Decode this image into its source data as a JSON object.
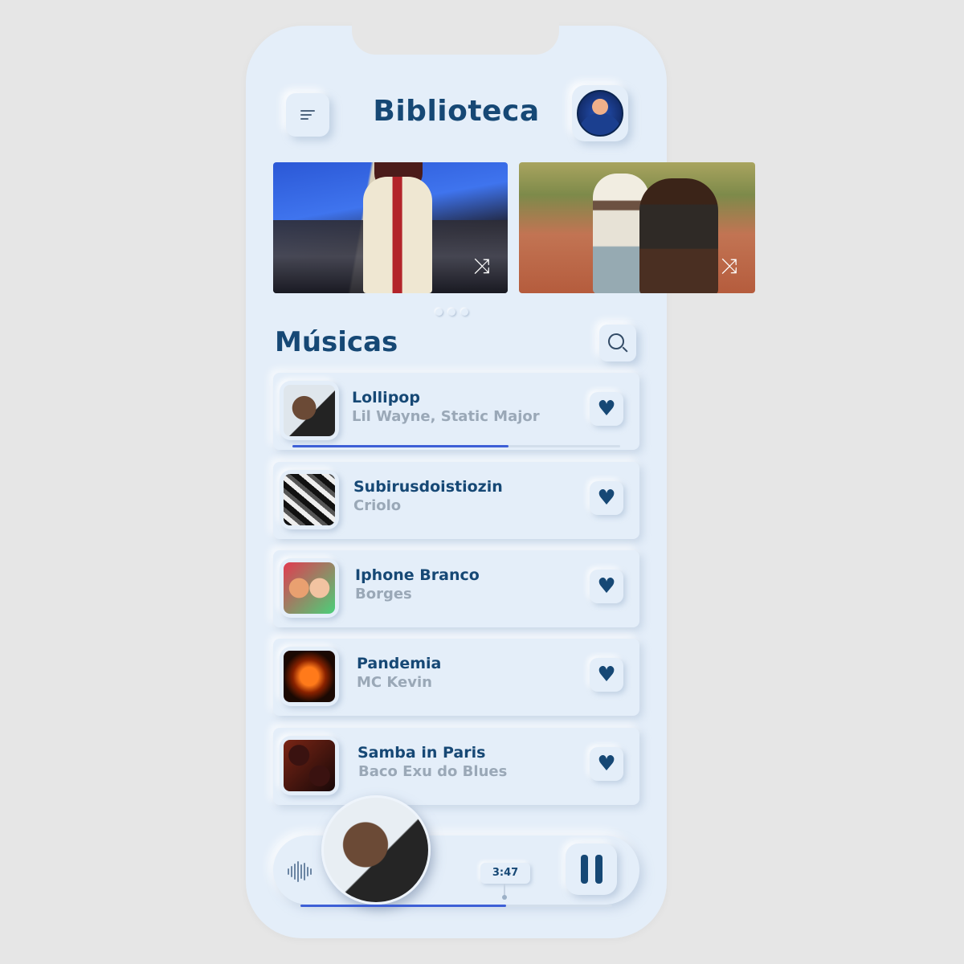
{
  "header": {
    "title": "Biblioteca",
    "menu_icon": "menu-icon",
    "avatar_icon": "user-avatar"
  },
  "carousel": {
    "cards": [
      {
        "action_icon": "shuffle-icon",
        "glyph": "⤨"
      },
      {
        "action_icon": "shuffle-icon",
        "glyph": "⤨"
      }
    ],
    "page_count": 3,
    "active_page": 1
  },
  "songs": {
    "title": "Músicas",
    "search_icon": "search-icon",
    "items": [
      {
        "title": "Lollipop",
        "artist": "Lil Wayne, Static Major",
        "heart": "♥",
        "progress": 0.66
      },
      {
        "title": "Subirusdoistiozin",
        "artist": "Criolo",
        "heart": "♥"
      },
      {
        "title": "Iphone Branco",
        "artist": "Borges",
        "heart": "♥"
      },
      {
        "title": "Pandemia",
        "artist": "MC Kevin",
        "heart": "♥"
      },
      {
        "title": "Samba in Paris",
        "artist": "Baco Exu do Blues",
        "heart": "♥"
      }
    ]
  },
  "player": {
    "time": "3:47",
    "progress": 0.66,
    "pause_icon": "pause-icon",
    "wave_icon": "waveform-icon"
  },
  "colors": {
    "accent": "#164875",
    "progress": "#3d5fd6",
    "background": "#e4eef9",
    "muted_text": "#9aa8b7"
  }
}
